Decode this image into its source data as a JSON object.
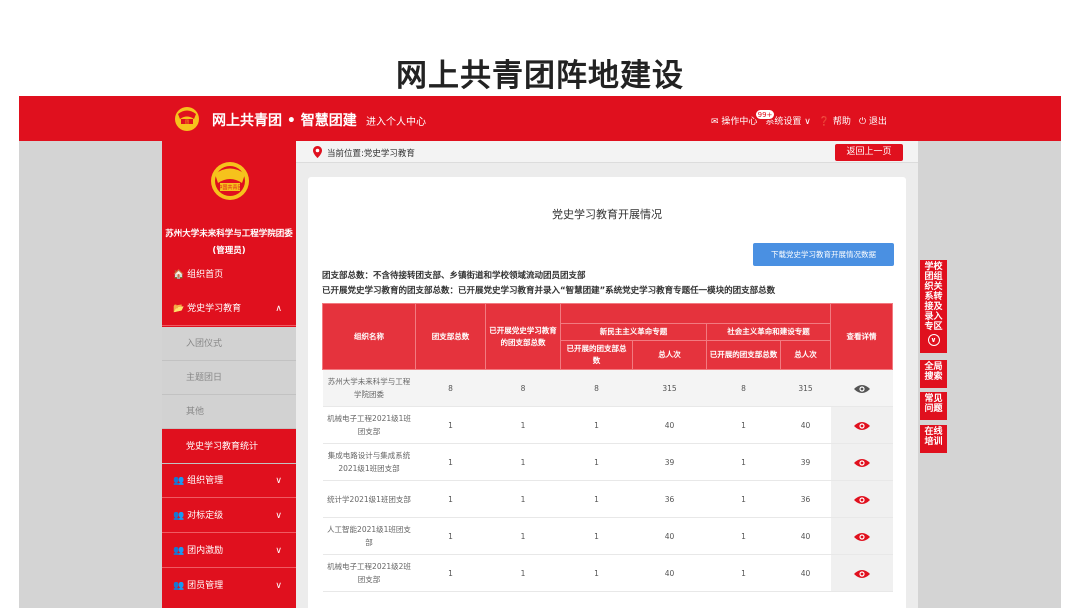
{
  "slide_title": "网上共青团阵地建设",
  "topbar": {
    "brand": "网上共青团 • 智慧团建",
    "personal_center": "进入个人中心",
    "nav": {
      "operations_label": "✉ 操作中心",
      "operations_badge": "99+",
      "settings_label": "系统设置 ∨",
      "help_label": "❓ 帮助",
      "logout_label": "⏻ 退出"
    }
  },
  "sidebar": {
    "org_line1": "苏州大学未来科学与工程学院团委",
    "org_line2": "(管理员)",
    "items": [
      {
        "label": "🏠 组织首页"
      },
      {
        "label": "📂 党史学习教育",
        "chev": "∧"
      },
      {
        "label": "入团仪式"
      },
      {
        "label": "主题团日"
      },
      {
        "label": "其他"
      },
      {
        "label": "党史学习教育统计"
      },
      {
        "label": "👥 组织管理",
        "chev": "∨"
      },
      {
        "label": "👥 对标定级",
        "chev": "∨"
      },
      {
        "label": "👥 团内激励",
        "chev": "∨"
      },
      {
        "label": "👥 团员管理",
        "chev": "∨"
      }
    ]
  },
  "breadcrumb": {
    "label": "当前位置:党史学习教育",
    "back_button": "返回上一页"
  },
  "card": {
    "title": "党史学习教育开展情况",
    "download_button": "下载党史学习教育开展情况数据",
    "note1": "团支部总数：不含待接转团支部、乡镇街道和学校领域流动团员团支部",
    "note2": "已开展党史学习教育的团支部总数：已开展党史学习教育并录入“智慧团建”系统党史学习教育专题任一模块的团支部总数"
  },
  "table": {
    "headers": {
      "org_name": "组织名称",
      "branch_total": "团支部总数",
      "branches_done": "已开展党史学习教育的团支部总数",
      "group1": "新民主主义革命专题",
      "group2": "社会主义革命和建设专题",
      "sub_branches": "已开展的团支部总数",
      "sub_people": "总人次",
      "details": "查看详情"
    },
    "rows": [
      {
        "name": "苏州大学未来科学与工程学院团委",
        "total": "8",
        "done": "8",
        "g1_branches": "8",
        "g1_people": "315",
        "g2_branches": "8",
        "g2_people": "315",
        "highlight": false
      },
      {
        "name": "机械电子工程2021级1班团支部",
        "total": "1",
        "done": "1",
        "g1_branches": "1",
        "g1_people": "40",
        "g2_branches": "1",
        "g2_people": "40",
        "highlight": true
      },
      {
        "name": "集成电路设计与集成系统2021级1班团支部",
        "total": "1",
        "done": "1",
        "g1_branches": "1",
        "g1_people": "39",
        "g2_branches": "1",
        "g2_people": "39",
        "highlight": true
      },
      {
        "name": "统计学2021级1班团支部",
        "total": "1",
        "done": "1",
        "g1_branches": "1",
        "g1_people": "36",
        "g2_branches": "1",
        "g2_people": "36",
        "highlight": true
      },
      {
        "name": "人工智能2021级1班团支部",
        "total": "1",
        "done": "1",
        "g1_branches": "1",
        "g1_people": "40",
        "g2_branches": "1",
        "g2_people": "40",
        "highlight": true
      },
      {
        "name": "机械电子工程2021级2班团支部",
        "total": "1",
        "done": "1",
        "g1_branches": "1",
        "g1_people": "40",
        "g2_branches": "1",
        "g2_people": "40",
        "highlight": true
      }
    ]
  },
  "right_tabs": [
    {
      "label": "学校团组织关系转接及录入专区"
    },
    {
      "label": "全局搜索"
    },
    {
      "label": "常见问题"
    },
    {
      "label": "在线培训"
    }
  ],
  "colors": {
    "brand_red": "#e0101e",
    "header_red": "#e5333d",
    "download_blue": "#4a90e2"
  }
}
